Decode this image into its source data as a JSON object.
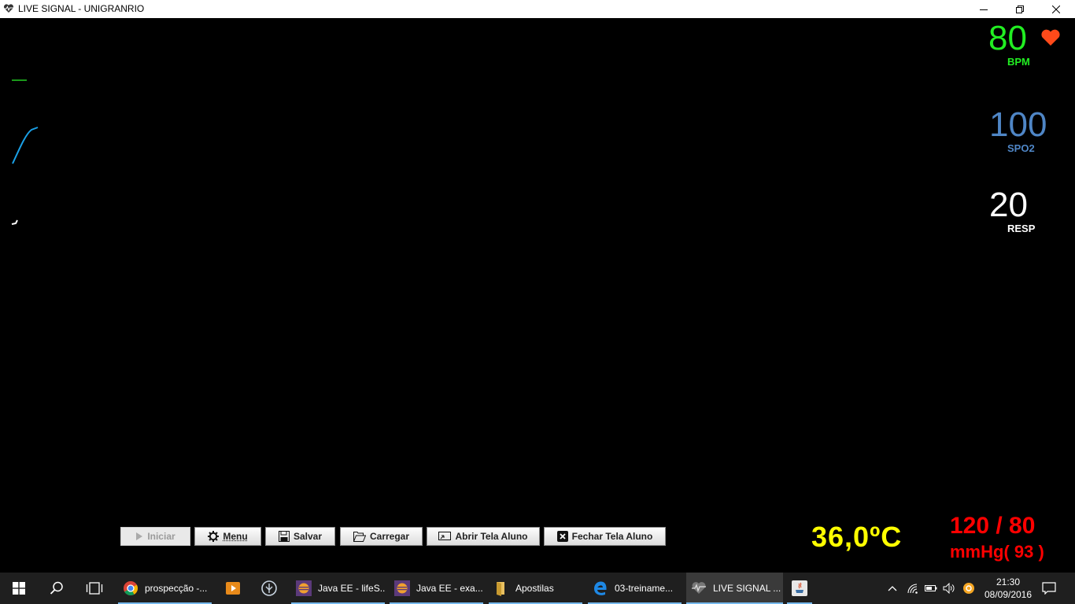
{
  "window": {
    "title": "LIVE SIGNAL - UNIGRANRIO",
    "icon": "heart-pulse-icon",
    "controls": [
      "minimize-icon",
      "maximize-icon",
      "close-icon"
    ]
  },
  "vitals": {
    "heart_rate": {
      "value": "80",
      "label": "BPM",
      "color": "#22ee22",
      "icon": "heart-icon",
      "icon_color": "#ff4a1a"
    },
    "spo2": {
      "value": "100",
      "label": "SPO2",
      "color": "#4f86c6"
    },
    "resp": {
      "value": "20",
      "label": "RESP",
      "color": "#ffffff"
    },
    "temperature": {
      "value": "36,0ºC",
      "color": "#ffff00"
    },
    "blood_pressure": {
      "value": "120 / 80",
      "unit": "mmHg( 93 )",
      "color": "#ff0000"
    }
  },
  "waveforms": {
    "ecg_color": "#22cc22",
    "pleth_color": "#1aa0e6",
    "resp_color": "#ffffff"
  },
  "toolbar": {
    "start_label": "Iniciar",
    "menu_label": "Menu",
    "save_label": "Salvar",
    "load_label": "Carregar",
    "open_student_label": "Abrir Tela Aluno",
    "close_student_label": "Fechar Tela Aluno"
  },
  "taskbar": {
    "apps": [
      {
        "label": "prospecção -...",
        "icon": "chrome-icon"
      },
      {
        "label": "",
        "icon": "media-player-icon"
      },
      {
        "label": "",
        "icon": "app-icon"
      },
      {
        "label": "Java EE - lifeS...",
        "icon": "eclipse-icon"
      },
      {
        "label": "Java EE - exa...",
        "icon": "eclipse-icon"
      },
      {
        "label": "Apostilas",
        "icon": "folder-icon"
      },
      {
        "label": "03-treiname...",
        "icon": "edge-icon"
      },
      {
        "label": "LIVE SIGNAL ...",
        "icon": "heart-pulse-icon"
      },
      {
        "label": "",
        "icon": "java-icon"
      }
    ],
    "clock": {
      "time": "21:30",
      "date": "08/09/2016"
    }
  }
}
